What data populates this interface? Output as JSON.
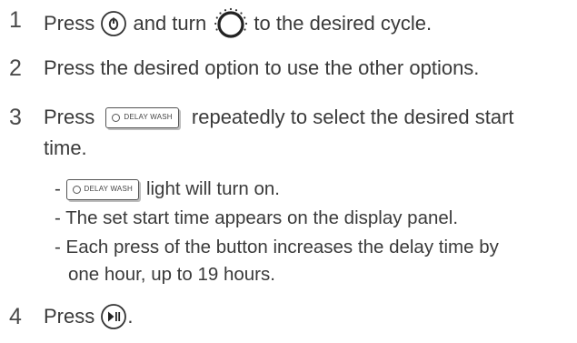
{
  "steps": [
    {
      "number": "1",
      "text_a": "Press ",
      "power_icon": "power-button-icon",
      "text_b": " and turn ",
      "dial_icon": "cycle-dial-icon",
      "text_c": " to the desired cycle."
    },
    {
      "number": "2",
      "text": "Press the desired option to use the other options."
    },
    {
      "number": "3",
      "text_a": "Press ",
      "button_label": "DELAY WASH",
      "text_b": " repeatedly to select the desired start",
      "text_cont": "time.",
      "bullets": [
        {
          "dash": "- ",
          "button_label": "DELAY WASH",
          "text": "light will turn on."
        },
        {
          "text": "- The set start time appears on the display panel."
        },
        {
          "text": "- Each press of the button increases the delay time by",
          "text_cont": "one hour, up to 19 hours."
        }
      ]
    },
    {
      "number": "4",
      "text_a": "Press ",
      "start_icon": "start-pause-button-icon",
      "text_b": "."
    }
  ]
}
